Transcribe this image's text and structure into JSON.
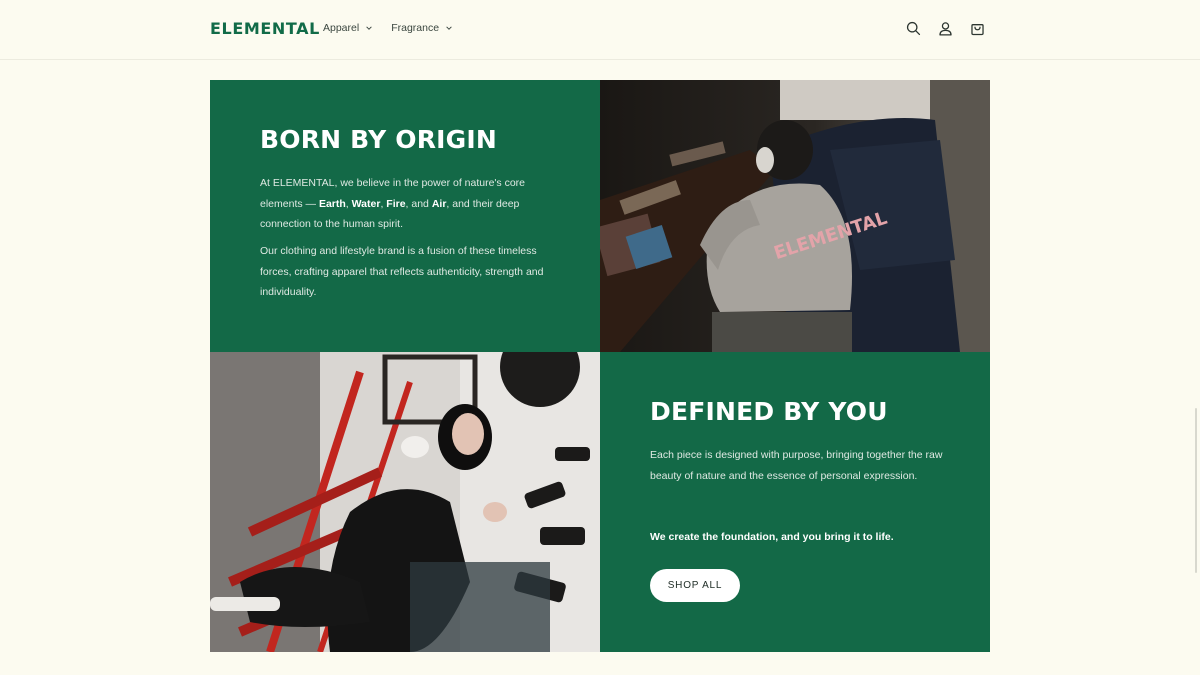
{
  "header": {
    "logo": "ELEMENTAL",
    "nav": [
      {
        "label": "Apparel"
      },
      {
        "label": "Fragrance"
      }
    ],
    "icons": [
      "search-icon",
      "account-icon",
      "cart-icon"
    ]
  },
  "section1": {
    "heading": "BORN BY ORIGIN",
    "p1_intro": "At ELEMENTAL, we believe in the power of nature's core elements — ",
    "p1_earth": "Earth",
    "p1_sep1": ", ",
    "p1_water": "Water",
    "p1_sep2": ", ",
    "p1_fire": "Fire",
    "p1_sep3": ", and ",
    "p1_air": "Air",
    "p1_end": ", and their deep connection to the human spirit.",
    "p2": "Our clothing and lifestyle brand is a fusion of these timeless forces, crafting apparel that reflects authenticity, strength and individuality."
  },
  "section2": {
    "heading": "DEFINED BY YOU",
    "p1": "Each piece is designed with purpose, bringing together the raw beauty of nature and the essence of personal expression.",
    "p2": "We create the foundation, and you bring it to life.",
    "button": "SHOP ALL"
  },
  "photos": {
    "photo1_print": "ELEMENTAL"
  },
  "colors": {
    "brand_green": "#136947",
    "logo_green": "#116b48",
    "background": "#fcfbf0"
  }
}
